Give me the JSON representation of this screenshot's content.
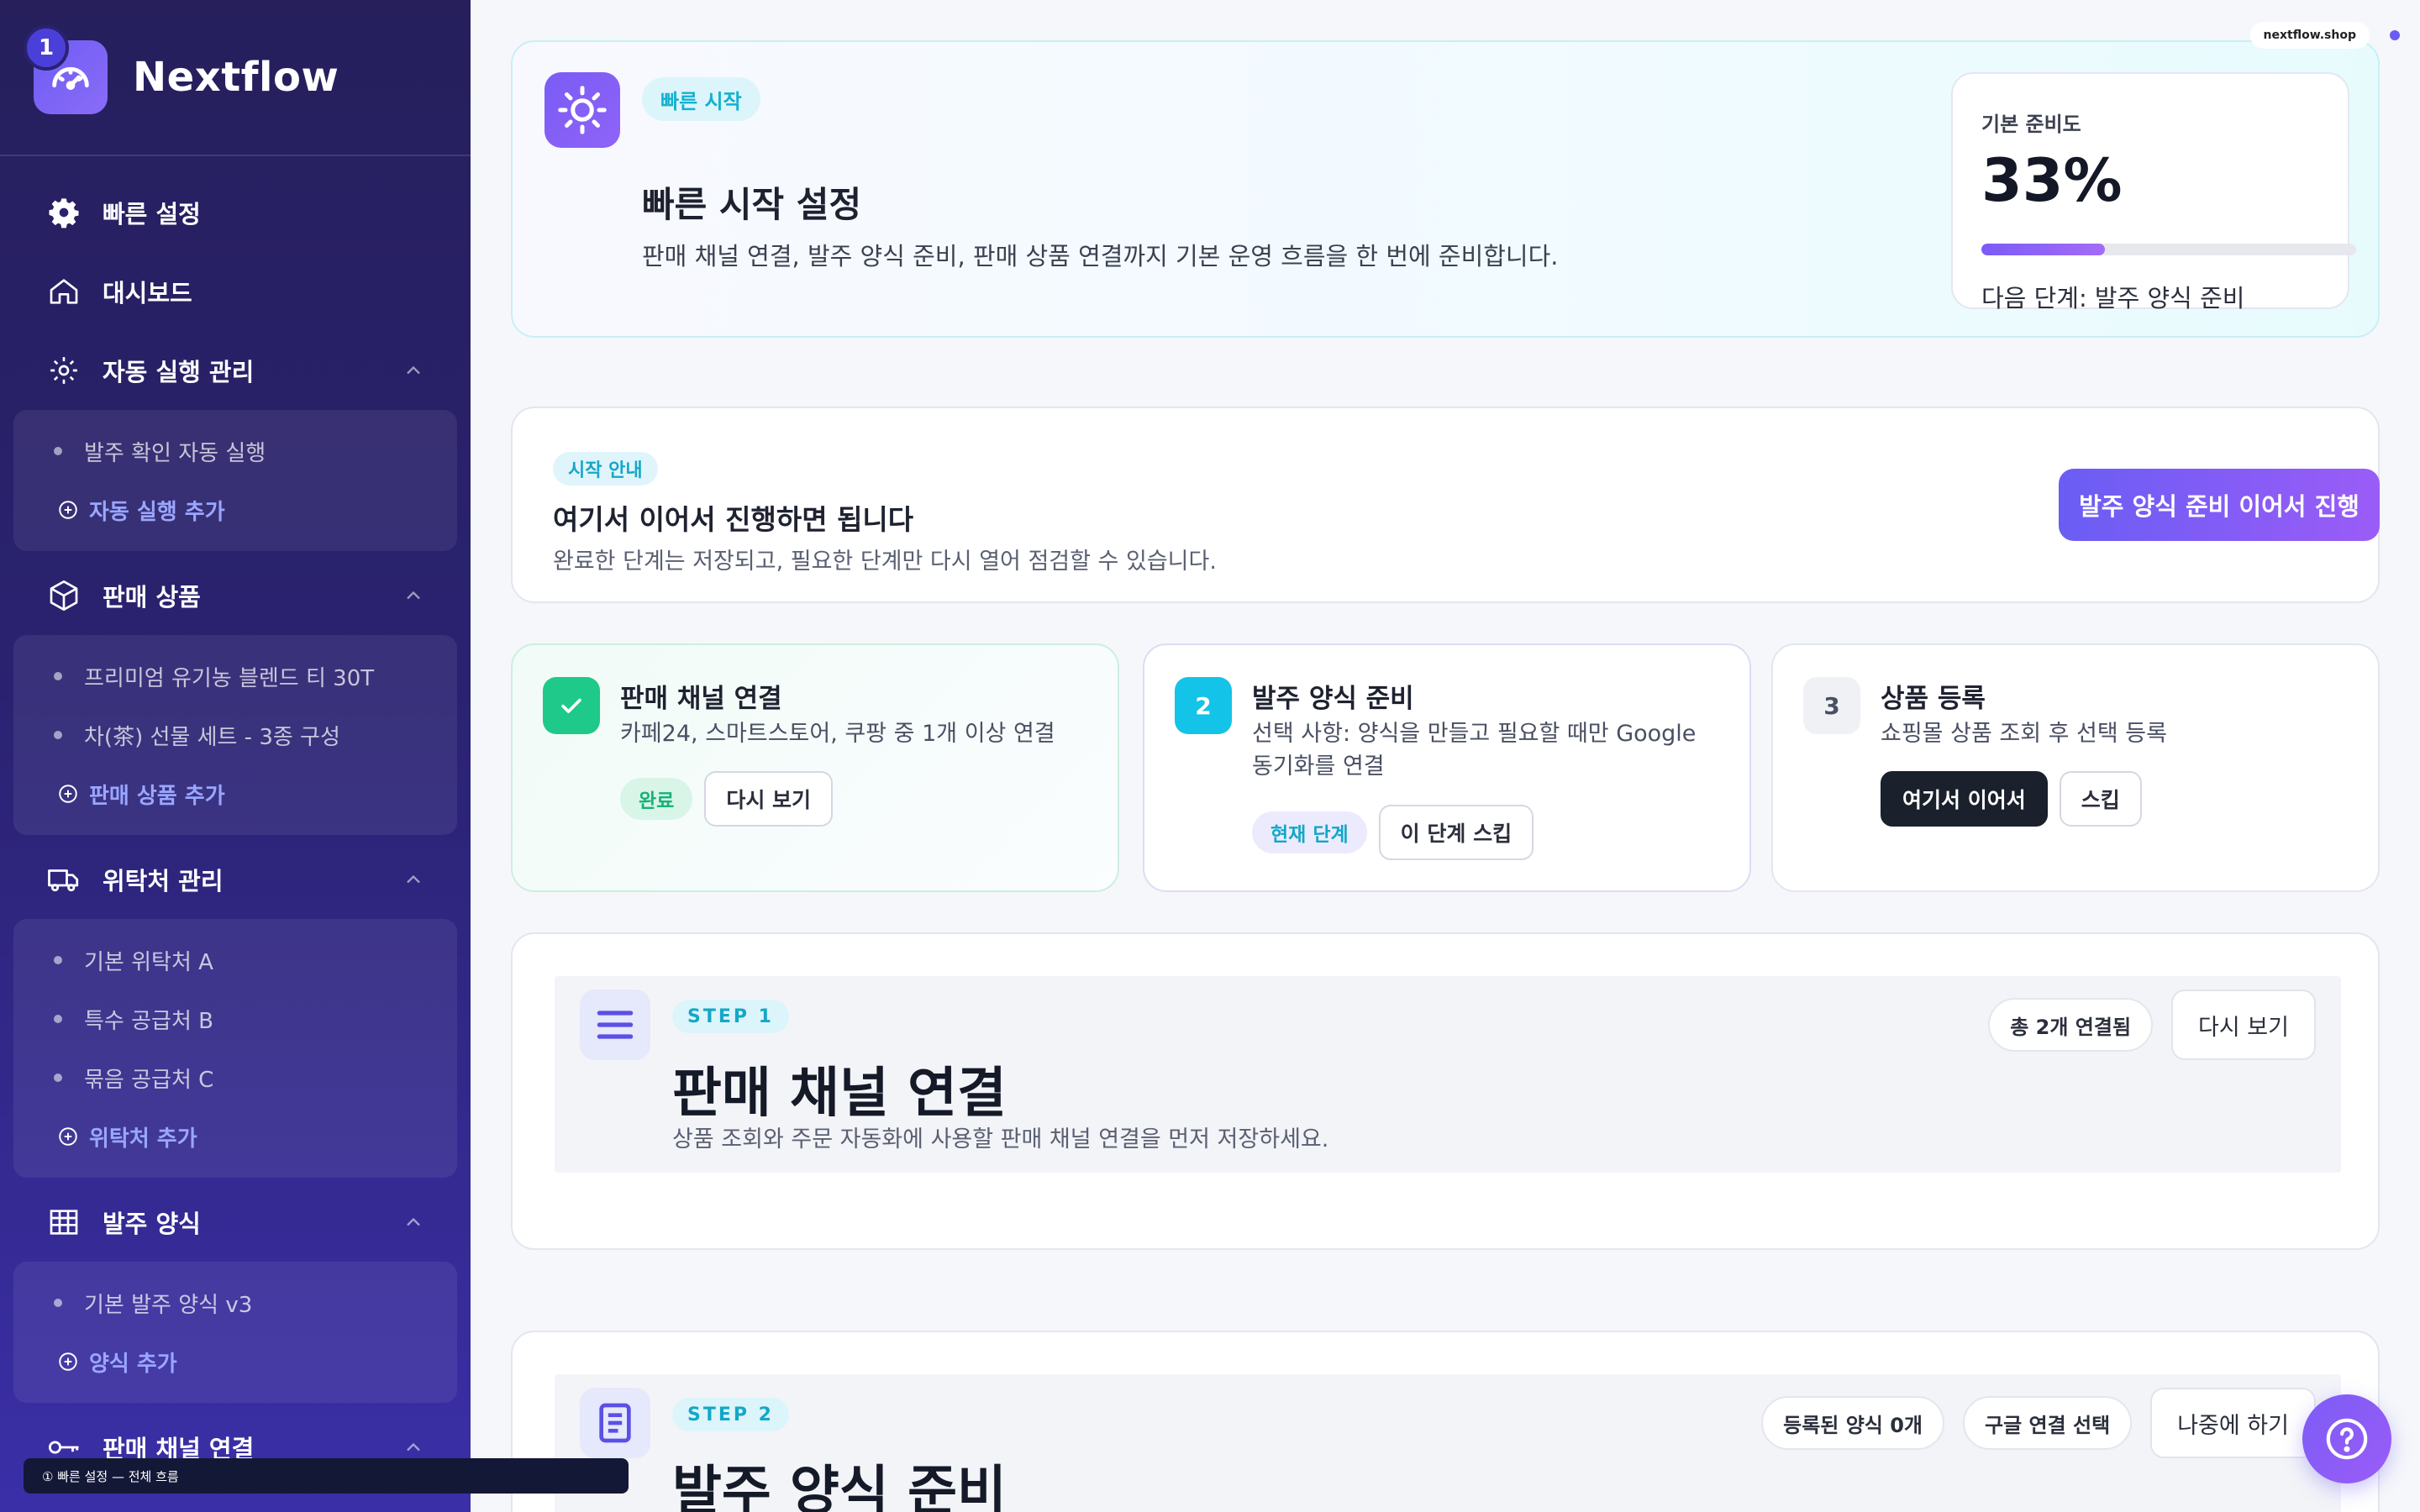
{
  "brand": {
    "name": "Nextflow",
    "badge": "1"
  },
  "sidebar": {
    "items": [
      {
        "label": "빠른 설정",
        "icon": "gear-icon"
      },
      {
        "label": "대시보드",
        "icon": "home-icon"
      },
      {
        "label": "자동 실행 관리",
        "icon": "settings-icon",
        "subitems": [
          "발주 확인 자동 실행"
        ],
        "add_label": "자동 실행 추가"
      },
      {
        "label": "판매 상품",
        "icon": "box-icon",
        "subitems": [
          "프리미엄 유기농 블렌드 티 30T",
          "차(茶) 선물 세트 - 3종 구성"
        ],
        "add_label": "판매 상품 추가"
      },
      {
        "label": "위탁처 관리",
        "icon": "truck-icon",
        "subitems": [
          "기본 위탁처 A",
          "특수 공급처 B",
          "묶음 공급처 C"
        ],
        "add_label": "위탁처 추가"
      },
      {
        "label": "발주 양식",
        "icon": "table-icon",
        "subitems": [
          "기본 발주 양식 v3"
        ],
        "add_label": "양식 추가"
      },
      {
        "label": "판매 채널 연결",
        "icon": "key-icon"
      }
    ]
  },
  "toast": {
    "text": "① 빠른 설정 — 전체 흐름"
  },
  "site": {
    "domain": "nextflow.shop"
  },
  "hero": {
    "pill": "빠른 시작",
    "title": "빠른 시작 설정",
    "description": "판매 채널 연결, 발주 양식 준비, 판매 상품 연결까지 기본 운영 흐름을 한 번에 준비합니다.",
    "readiness": {
      "label": "기본 준비도",
      "value": "33%",
      "progress": 0.33,
      "next": "다음 단계: 발주 양식 준비"
    }
  },
  "guide": {
    "pill": "시작 안내",
    "title": "여기서 이어서 진행하면 됩니다",
    "description": "완료한 단계는 저장되고, 필요한 단계만 다시 열어 점검할 수 있습니다.",
    "cta": "발주 양식 준비 이어서 진행"
  },
  "steps": [
    {
      "number": "✓",
      "title": "판매 채널 연결",
      "description": "카페24, 스마트스토어, 쿠팡 중 1개 이상 연결",
      "status": "완료",
      "action": "다시 보기"
    },
    {
      "number": "2",
      "title": "발주 양식 준비",
      "description": "선택 사항: 양식을 만들고 필요할 때만 Google 동기화를 연결",
      "status": "현재 단계",
      "action": "이 단계 스킵"
    },
    {
      "number": "3",
      "title": "상품 등록",
      "description": "쇼핑몰 상품 조회 후 선택 등록",
      "primary": "여기서 이어서",
      "action": "스킵"
    }
  ],
  "step1": {
    "pill": "STEP 1",
    "title": "판매 채널 연결",
    "description": "상품 조회와 주문 자동화에 사용할 판매 채널 연결을 먼저 저장하세요.",
    "chip": "총 2개 연결됨",
    "button": "다시 보기"
  },
  "step2": {
    "pill": "STEP 2",
    "title": "발주 양식 준비",
    "chips": [
      "등록된 양식 0개",
      "구글 연결 선택"
    ],
    "button": "나중에 하기"
  },
  "colors": {
    "accent": "#6a5df4",
    "success": "#1ec98a",
    "cyan": "#14c3e8",
    "sidebar": "#2a2270"
  }
}
